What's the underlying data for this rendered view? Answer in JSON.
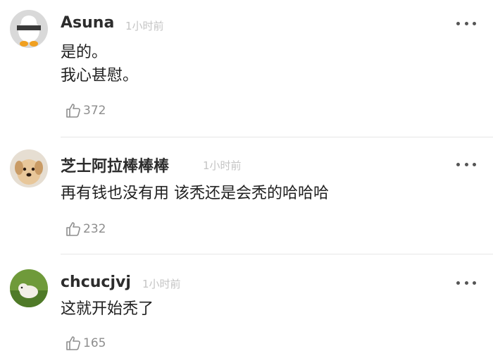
{
  "comments": [
    {
      "username": "Asuna",
      "time": "1小时前",
      "text_lines": [
        "是的。",
        "我心甚慰。"
      ],
      "likes": "372",
      "avatar_icon": "duck-avatar"
    },
    {
      "username": "芝士阿拉棒棒棒",
      "time": "1小时前",
      "text_lines": [
        "再有钱也没有用 该秃还是会秃的哈哈哈"
      ],
      "likes": "232",
      "avatar_icon": "dog-avatar"
    },
    {
      "username": "chcucjvj",
      "time": "1小时前",
      "text_lines": [
        "这就开始秃了"
      ],
      "likes": "165",
      "avatar_icon": "dog-grass-avatar"
    }
  ],
  "colors": {
    "username": "#2c2c2c",
    "time": "#c4c4c4",
    "likes": "#8e8e8e",
    "divider": "#e6e6e6"
  }
}
